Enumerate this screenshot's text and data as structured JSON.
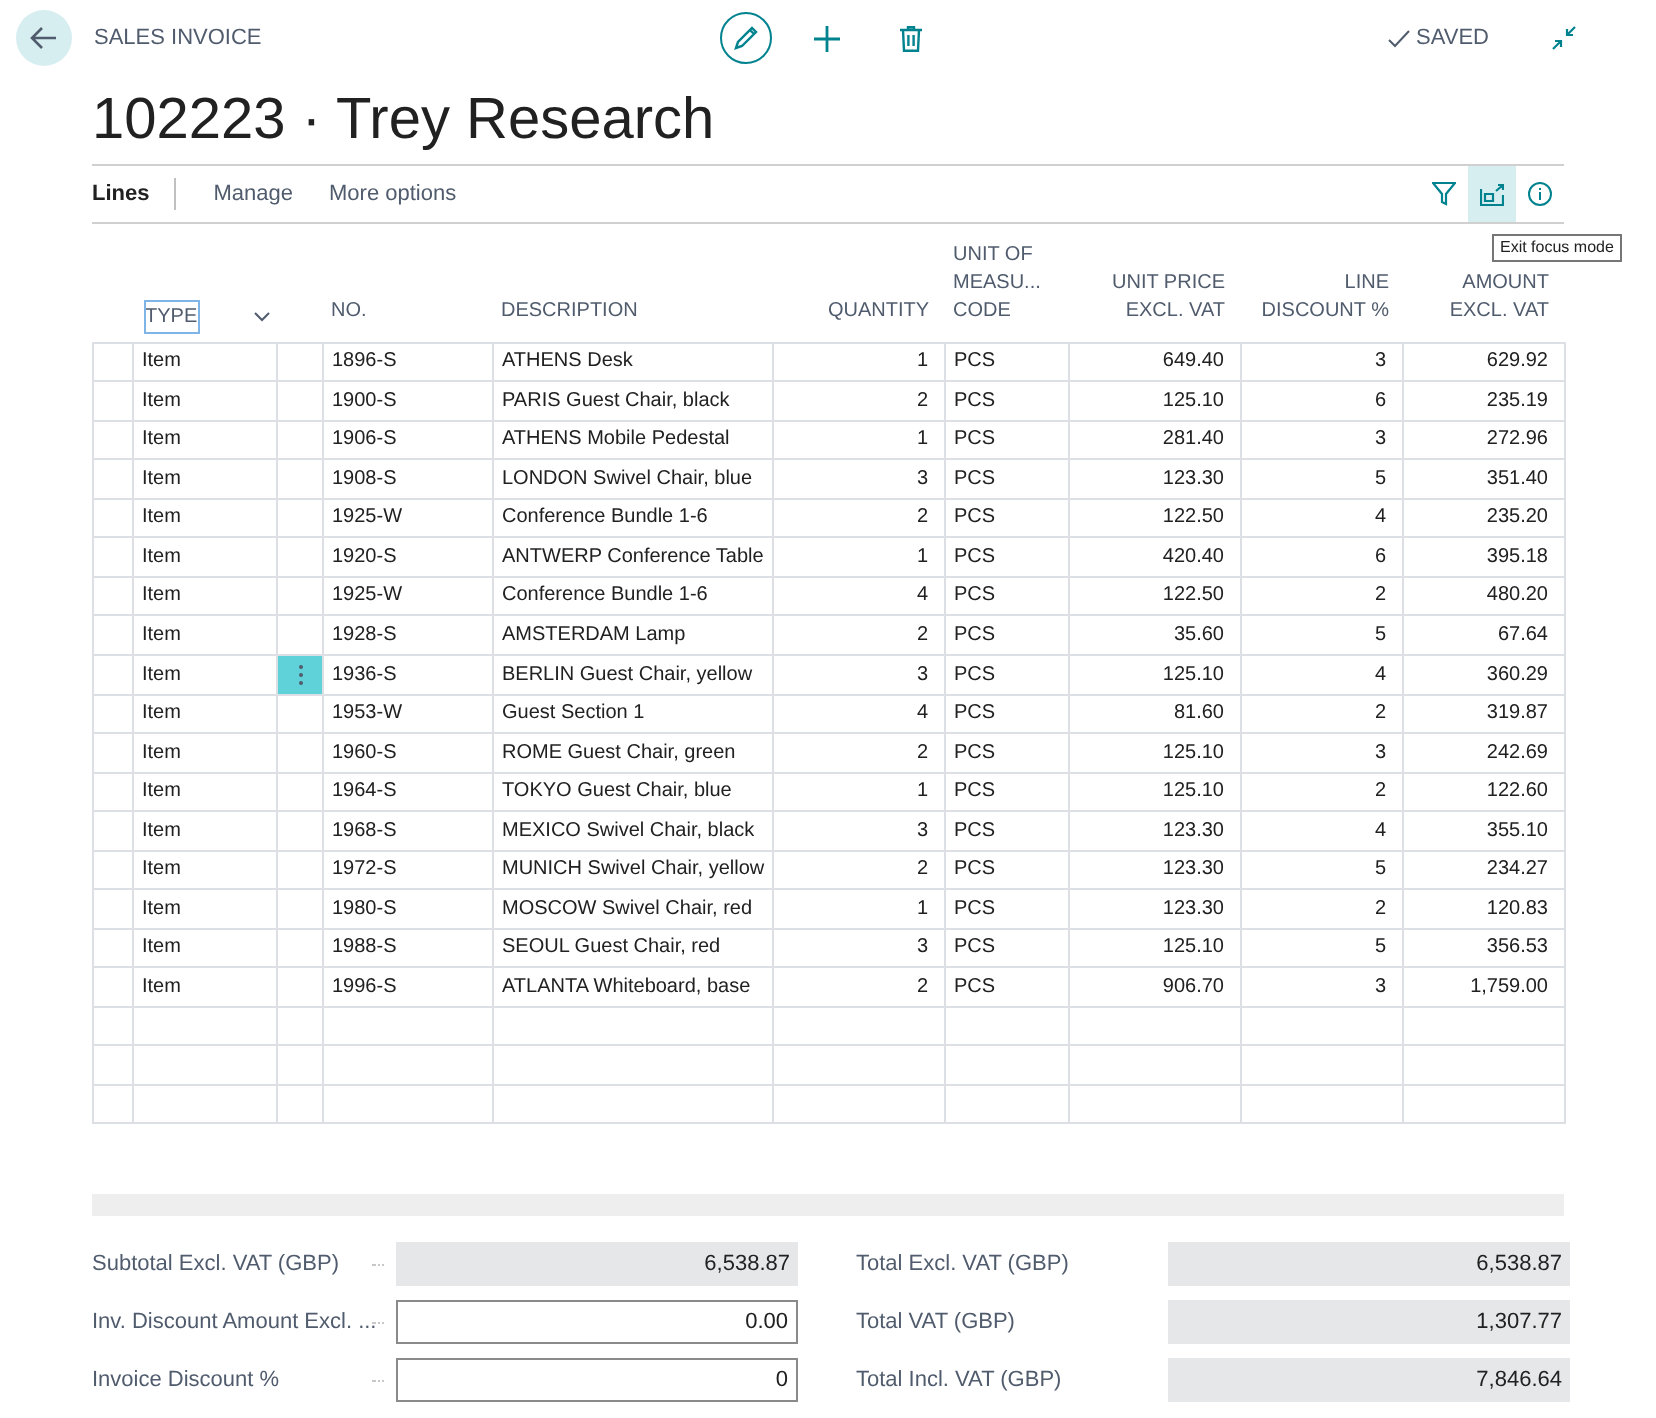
{
  "header": {
    "page_type": "SALES INVOICE",
    "title": "102223 · Trey Research",
    "status": "SAVED"
  },
  "toolbar": {
    "tabs": [
      {
        "label": "Lines",
        "selected": true
      },
      {
        "label": "Manage",
        "selected": false
      },
      {
        "label": "More options",
        "selected": false
      }
    ],
    "focus_mode_on": true,
    "tooltip": "Exit focus mode"
  },
  "table": {
    "columns": [
      "TYPE",
      "NO.",
      "DESCRIPTION",
      "QUANTITY",
      "UNIT OF MEASU... CODE",
      "UNIT PRICE EXCL. VAT",
      "LINE DISCOUNT %",
      "AMOUNT EXCL. VAT"
    ],
    "rows": [
      {
        "type": "Item",
        "no": "1896-S",
        "description": "ATHENS Desk",
        "quantity": "1",
        "uom": "PCS",
        "unit_price": "649.40",
        "discount": "3",
        "amount": "629.92",
        "active": false
      },
      {
        "type": "Item",
        "no": "1900-S",
        "description": "PARIS Guest Chair, black",
        "quantity": "2",
        "uom": "PCS",
        "unit_price": "125.10",
        "discount": "6",
        "amount": "235.19",
        "active": false
      },
      {
        "type": "Item",
        "no": "1906-S",
        "description": "ATHENS Mobile Pedestal",
        "quantity": "1",
        "uom": "PCS",
        "unit_price": "281.40",
        "discount": "3",
        "amount": "272.96",
        "active": false
      },
      {
        "type": "Item",
        "no": "1908-S",
        "description": "LONDON Swivel Chair, blue",
        "quantity": "3",
        "uom": "PCS",
        "unit_price": "123.30",
        "discount": "5",
        "amount": "351.40",
        "active": false
      },
      {
        "type": "Item",
        "no": "1925-W",
        "description": "Conference Bundle 1-6",
        "quantity": "2",
        "uom": "PCS",
        "unit_price": "122.50",
        "discount": "4",
        "amount": "235.20",
        "active": false
      },
      {
        "type": "Item",
        "no": "1920-S",
        "description": "ANTWERP Conference Table",
        "quantity": "1",
        "uom": "PCS",
        "unit_price": "420.40",
        "discount": "6",
        "amount": "395.18",
        "active": false
      },
      {
        "type": "Item",
        "no": "1925-W",
        "description": "Conference Bundle 1-6",
        "quantity": "4",
        "uom": "PCS",
        "unit_price": "122.50",
        "discount": "2",
        "amount": "480.20",
        "active": false
      },
      {
        "type": "Item",
        "no": "1928-S",
        "description": "AMSTERDAM Lamp",
        "quantity": "2",
        "uom": "PCS",
        "unit_price": "35.60",
        "discount": "5",
        "amount": "67.64",
        "active": false
      },
      {
        "type": "Item",
        "no": "1936-S",
        "description": "BERLIN Guest Chair, yellow",
        "quantity": "3",
        "uom": "PCS",
        "unit_price": "125.10",
        "discount": "4",
        "amount": "360.29",
        "active": true
      },
      {
        "type": "Item",
        "no": "1953-W",
        "description": "Guest Section 1",
        "quantity": "4",
        "uom": "PCS",
        "unit_price": "81.60",
        "discount": "2",
        "amount": "319.87",
        "active": false
      },
      {
        "type": "Item",
        "no": "1960-S",
        "description": "ROME Guest Chair, green",
        "quantity": "2",
        "uom": "PCS",
        "unit_price": "125.10",
        "discount": "3",
        "amount": "242.69",
        "active": false
      },
      {
        "type": "Item",
        "no": "1964-S",
        "description": "TOKYO Guest Chair, blue",
        "quantity": "1",
        "uom": "PCS",
        "unit_price": "125.10",
        "discount": "2",
        "amount": "122.60",
        "active": false
      },
      {
        "type": "Item",
        "no": "1968-S",
        "description": "MEXICO Swivel Chair, black",
        "quantity": "3",
        "uom": "PCS",
        "unit_price": "123.30",
        "discount": "4",
        "amount": "355.10",
        "active": false
      },
      {
        "type": "Item",
        "no": "1972-S",
        "description": "MUNICH Swivel Chair, yellow",
        "quantity": "2",
        "uom": "PCS",
        "unit_price": "123.30",
        "discount": "5",
        "amount": "234.27",
        "active": false
      },
      {
        "type": "Item",
        "no": "1980-S",
        "description": "MOSCOW Swivel Chair, red",
        "quantity": "1",
        "uom": "PCS",
        "unit_price": "123.30",
        "discount": "2",
        "amount": "120.83",
        "active": false
      },
      {
        "type": "Item",
        "no": "1988-S",
        "description": "SEOUL Guest Chair, red",
        "quantity": "3",
        "uom": "PCS",
        "unit_price": "125.10",
        "discount": "5",
        "amount": "356.53",
        "active": false
      },
      {
        "type": "Item",
        "no": "1996-S",
        "description": "ATLANTA Whiteboard, base",
        "quantity": "2",
        "uom": "PCS",
        "unit_price": "906.70",
        "discount": "3",
        "amount": "1,759.00",
        "active": false
      }
    ]
  },
  "totals": {
    "left": [
      {
        "label": "Subtotal Excl. VAT (GBP)",
        "value": "6,538.87",
        "editable": false
      },
      {
        "label": "Inv. Discount Amount Excl. ...",
        "value": "0.00",
        "editable": true
      },
      {
        "label": "Invoice Discount %",
        "value": "0",
        "editable": true
      }
    ],
    "right": [
      {
        "label": "Total Excl. VAT (GBP)",
        "value": "6,538.87",
        "editable": false
      },
      {
        "label": "Total VAT (GBP)",
        "value": "1,307.77",
        "editable": false
      },
      {
        "label": "Total Incl. VAT (GBP)",
        "value": "7,846.64",
        "editable": false
      }
    ]
  }
}
